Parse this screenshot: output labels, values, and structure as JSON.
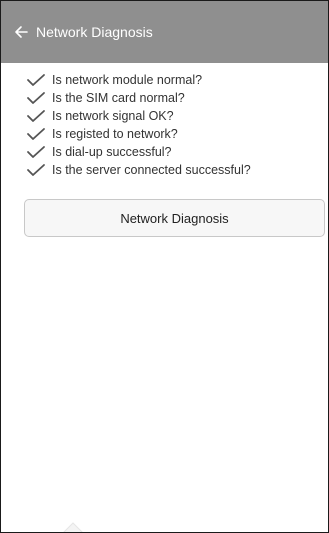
{
  "appbar": {
    "title": "Network Diagnosis",
    "back_icon": "arrow-left-icon"
  },
  "checks": [
    {
      "label": "Is network module normal?",
      "status": "ok"
    },
    {
      "label": "Is the SIM card normal?",
      "status": "ok"
    },
    {
      "label": "Is network signal OK?",
      "status": "ok"
    },
    {
      "label": "Is registed to network?",
      "status": "ok"
    },
    {
      "label": "Is dial-up successful?",
      "status": "ok"
    },
    {
      "label": "Is the server connected successful?",
      "status": "ok"
    }
  ],
  "actions": {
    "diagnose_label": "Network Diagnosis"
  },
  "colors": {
    "appbar": "#8f8f8f",
    "check": "#555555",
    "button_bg": "#f7f7f7",
    "button_border": "#c8c8c8"
  }
}
